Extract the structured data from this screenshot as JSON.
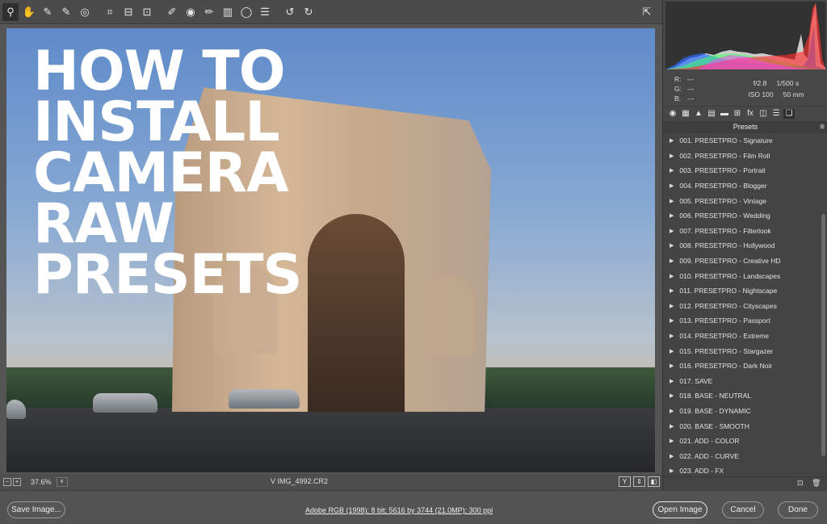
{
  "toolbar": {
    "tools": [
      "zoom-tool",
      "hand-tool",
      "white-balance-tool",
      "color-sampler-tool",
      "targeted-adjustment-tool",
      "crop-tool",
      "straighten-tool",
      "transform-tool",
      "spot-removal-tool",
      "red-eye-tool",
      "adjustment-brush-tool",
      "graduated-filter-tool",
      "radial-filter-tool",
      "preferences-tool",
      "rotate-left-tool",
      "rotate-right-tool"
    ],
    "glyphs": [
      "⚲",
      "✋",
      "✎",
      "✎",
      "◎",
      "⌗",
      "⊟",
      "⊡",
      "✐",
      "◉",
      "✏",
      "▥",
      "◯",
      "☰",
      "↺",
      "↻"
    ],
    "fullscreen_glyph": "⇱"
  },
  "image": {
    "headline_lines": [
      "HOW TO",
      "INSTALL",
      "CAMERA",
      "RAW",
      "PRESETS"
    ]
  },
  "status": {
    "zoom": "37.6%",
    "filename": "V IMG_4992.CR2",
    "zoom_out": "−",
    "zoom_in": "+",
    "zoom_dropdown": "∨",
    "view_buttons": [
      "Y",
      "⇕",
      "◧"
    ]
  },
  "readout": {
    "r_label": "R:",
    "r_value": "---",
    "g_label": "G:",
    "g_value": "---",
    "b_label": "B:",
    "b_value": "---",
    "aperture": "f/2.8",
    "shutter": "1/500 s",
    "iso": "ISO 100",
    "focal": "50 mm"
  },
  "panel_tabs": [
    "◉",
    "▦",
    "▲",
    "▤",
    "▬",
    "⊞",
    "fx",
    "◫",
    "☰",
    "❏"
  ],
  "presets": {
    "title": "Presets",
    "menu_glyph": "≡",
    "items": [
      "001. PRESETPRO - Signature",
      "002. PRESETPRO - Film Roll",
      "003. PRESETPRO - Portrait",
      "004. PRESETPRO - Blogger",
      "005. PRESETPRO - Vintage",
      "006. PRESETPRO - Wedding",
      "007. PRESETPRO - Filterlook",
      "008. PRESETPRO - Hollywood",
      "009. PRESETPRO - Creative HD",
      "010. PRESETPRO - Landscapes",
      "011. PRESETPRO - Nightscape",
      "012. PRESETPRO - Cityscapes",
      "013. PRESETPRO - Passport",
      "014. PRESETPRO - Extreme",
      "015. PRESETPRO - Stargazer",
      "016. PRESETPRO - Dark Noir",
      "017. SAVE",
      "018. BASE - NEUTRAL",
      "019. BASE - DYNAMIC",
      "020. BASE - SMOOTH",
      "021. ADD - COLOR",
      "022. ADD - CURVE",
      "023. ADD - FX"
    ],
    "new_glyph": "⊡",
    "delete_glyph": "🗑"
  },
  "bottom": {
    "save_image": "Save Image...",
    "workflow_info": "Adobe RGB (1998); 8 bit; 5616 by 3744 (21.0MP); 300 ppi",
    "open_image": "Open Image",
    "cancel": "Cancel",
    "done": "Done"
  },
  "colors": {
    "panel": "#474747",
    "background": "#535353",
    "text": "#dddddd"
  }
}
